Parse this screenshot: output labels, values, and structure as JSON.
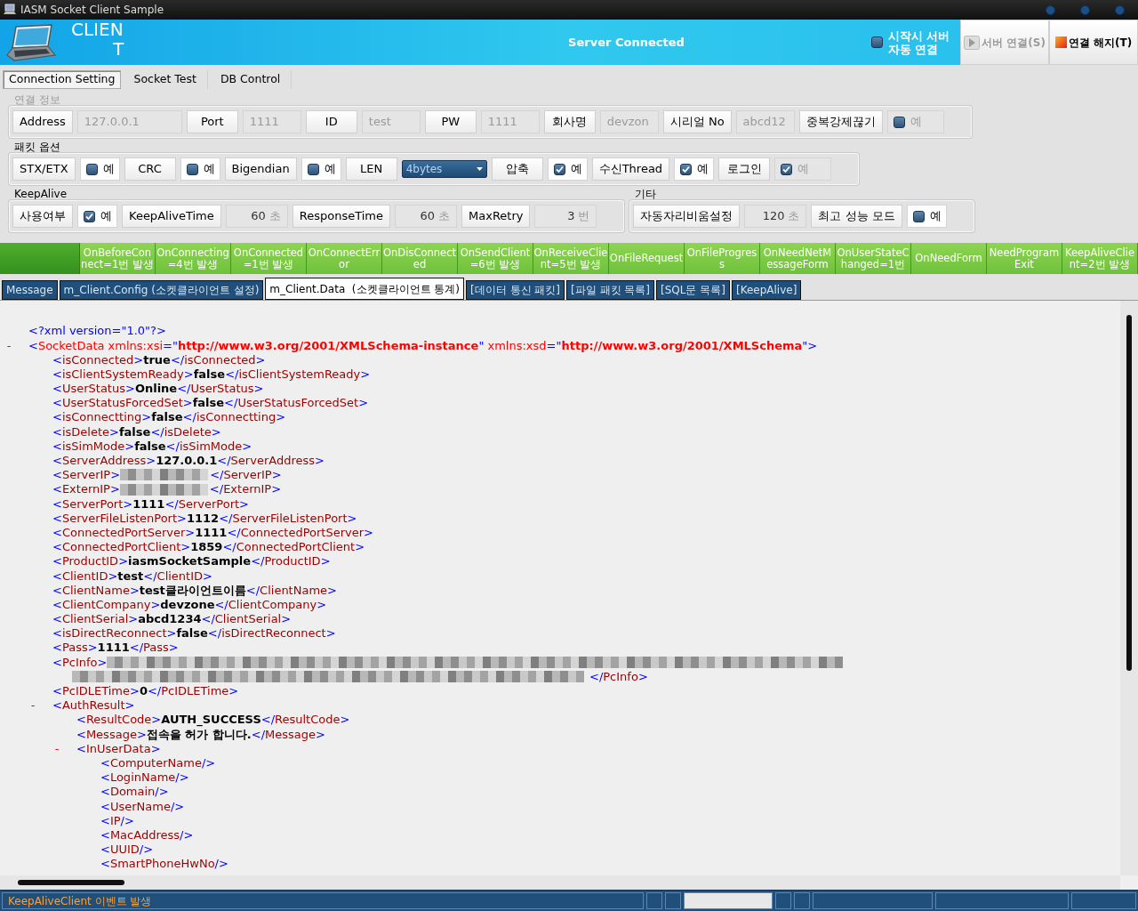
{
  "window": {
    "title": "IASM Socket Client Sample"
  },
  "header": {
    "logo_line_1": "CLIEN",
    "logo_line_2": "T",
    "status": "Server Connected",
    "auto_connect": {
      "label_lines": [
        "시작시 서버",
        "자동 연결"
      ],
      "checked": false
    },
    "buttons": [
      {
        "kind": "play",
        "label": "서버 연결(S)",
        "disabled": true
      },
      {
        "kind": "stop",
        "label": "연결 해지(T)",
        "disabled": false
      }
    ]
  },
  "main_tabs": [
    {
      "label": "Connection Setting",
      "selected": true
    },
    {
      "label": "Socket Test",
      "selected": false
    },
    {
      "label": "DB Control",
      "selected": false
    }
  ],
  "settings_rows": [
    {
      "groups": [
        {
          "legend": "연결 정보",
          "disabled": true,
          "items": [
            {
              "kind": "label",
              "text": "Address"
            },
            {
              "kind": "value",
              "text": "127.0.0.1",
              "wide": true
            },
            {
              "kind": "label",
              "text": "Port"
            },
            {
              "kind": "value",
              "text": "1111"
            },
            {
              "kind": "label",
              "text": "ID"
            },
            {
              "kind": "value",
              "text": "test"
            },
            {
              "kind": "label",
              "text": "PW"
            },
            {
              "kind": "value",
              "text": "1111"
            },
            {
              "kind": "label",
              "text": "회사명"
            },
            {
              "kind": "value",
              "text": "devzon"
            },
            {
              "kind": "label",
              "text": "시리얼 No"
            },
            {
              "kind": "value",
              "text": "abcd12"
            },
            {
              "kind": "label",
              "text": "중복강제끊기"
            },
            {
              "kind": "check",
              "text": "예",
              "checked": false,
              "disabled": true
            }
          ]
        }
      ]
    },
    {
      "groups": [
        {
          "legend": "패킷 옵션",
          "disabled": false,
          "items": [
            {
              "kind": "label",
              "text": "STX/ETX"
            },
            {
              "kind": "check",
              "text": "예",
              "checked": false,
              "disabled": false
            },
            {
              "kind": "label",
              "text": "CRC"
            },
            {
              "kind": "check",
              "text": "예",
              "checked": false,
              "disabled": false
            },
            {
              "kind": "label",
              "text": "Bigendian"
            },
            {
              "kind": "check",
              "text": "예",
              "checked": false,
              "disabled": false
            },
            {
              "kind": "label",
              "text": "LEN"
            },
            {
              "kind": "combo",
              "text": "4bytes"
            },
            {
              "kind": "label",
              "text": "압축"
            },
            {
              "kind": "check",
              "text": "예",
              "checked": true,
              "disabled": false
            },
            {
              "kind": "label",
              "text": "수신Thread"
            },
            {
              "kind": "check",
              "text": "예",
              "checked": true,
              "disabled": false
            },
            {
              "kind": "label",
              "text": "로그인"
            },
            {
              "kind": "check",
              "text": "예",
              "checked": true,
              "disabled": true
            }
          ]
        }
      ]
    },
    {
      "groups": [
        {
          "legend": "KeepAlive",
          "disabled": false,
          "items": [
            {
              "kind": "label",
              "text": "사용여부"
            },
            {
              "kind": "check",
              "text": "예",
              "checked": true,
              "disabled": false
            },
            {
              "kind": "label",
              "text": "KeepAliveTime"
            },
            {
              "kind": "value",
              "text": "60",
              "unit": "초"
            },
            {
              "kind": "label",
              "text": "ResponseTime"
            },
            {
              "kind": "value",
              "text": "60",
              "unit": "초"
            },
            {
              "kind": "label",
              "text": "MaxRetry"
            },
            {
              "kind": "value",
              "text": "3",
              "unit": "번"
            }
          ]
        },
        {
          "legend": "기타",
          "disabled": false,
          "items": [
            {
              "kind": "label",
              "text": "자동자리비움설정"
            },
            {
              "kind": "value",
              "text": "120",
              "unit": "초"
            },
            {
              "kind": "label",
              "text": "최고 성능 모드"
            },
            {
              "kind": "check",
              "text": "예",
              "checked": false,
              "disabled": false
            }
          ]
        }
      ]
    }
  ],
  "events": [
    {
      "lines": [
        "OnBeforeCon",
        "nect=1번 발생"
      ]
    },
    {
      "lines": [
        "OnConnecting",
        "=4번 발생"
      ]
    },
    {
      "lines": [
        "OnConnected",
        "=1번 발생"
      ]
    },
    {
      "lines": [
        "OnConnectErr",
        "or"
      ]
    },
    {
      "lines": [
        "OnDisConnect",
        "ed"
      ]
    },
    {
      "lines": [
        "OnSendClient",
        "=6번 발생"
      ]
    },
    {
      "lines": [
        "OnReceiveClie",
        "nt=5번 발생"
      ]
    },
    {
      "lines": [
        "OnFileRequest"
      ]
    },
    {
      "lines": [
        "OnFileProgres",
        "s"
      ]
    },
    {
      "lines": [
        "OnNeedNetM",
        "essageForm"
      ]
    },
    {
      "lines": [
        "OnUserStateC",
        "hanged=1번"
      ]
    },
    {
      "lines": [
        "OnNeedForm"
      ]
    },
    {
      "lines": [
        "NeedProgram",
        "Exit"
      ]
    },
    {
      "lines": [
        "KeepAliveClie",
        "nt=2번 발생"
      ]
    }
  ],
  "data_tabs": [
    {
      "label": "Message",
      "selected": false
    },
    {
      "label": "m_Client.Config (소켓클라이언트 설정)",
      "selected": false
    },
    {
      "label": "m_Client.Data  (소켓클라이언트 통계)",
      "selected": true
    },
    {
      "label": "[데이터 통신 패킷]",
      "selected": false
    },
    {
      "label": "[파일 패킷 목록]",
      "selected": false
    },
    {
      "label": "[SQL문 목록]",
      "selected": false
    },
    {
      "label": "[KeepAlive]",
      "selected": false
    }
  ],
  "xml": [
    {
      "kind": "decl",
      "open": "<?xml version=\"1.0\"?>"
    },
    {
      "kind": "element",
      "toggle": "-",
      "open": "<SocketData xmlns:xsi=\"http://www.w3.org/2001/XMLSchema-instance\" xmlns:xsd=\"http://www.w3.org/2001/XMLSchema\">",
      "children": [
        {
          "kind": "element",
          "open": "<isConnected>",
          "value": "true",
          "close": "</isConnected>"
        },
        {
          "kind": "element",
          "open": "<isClientSystemReady>",
          "value": "false",
          "close": "</isClientSystemReady>"
        },
        {
          "kind": "element",
          "open": "<UserStatus>",
          "value": "Online",
          "close": "</UserStatus>"
        },
        {
          "kind": "element",
          "open": "<UserStatusForcedSet>",
          "value": "false",
          "close": "</UserStatusForcedSet>"
        },
        {
          "kind": "element",
          "open": "<isConnectting>",
          "value": "false",
          "close": "</isConnectting>"
        },
        {
          "kind": "element",
          "open": "<isDelete>",
          "value": "false",
          "close": "</isDelete>"
        },
        {
          "kind": "element",
          "open": "<isSimMode>",
          "value": "false",
          "close": "</isSimMode>"
        },
        {
          "kind": "element",
          "open": "<ServerAddress>",
          "value": "127.0.0.1",
          "close": "</ServerAddress>"
        },
        {
          "kind": "masked",
          "open": "<ServerIP>",
          "close": "</ServerIP>"
        },
        {
          "kind": "masked",
          "open": "<ExternIP>",
          "close": "</ExternIP>"
        },
        {
          "kind": "element",
          "open": "<ServerPort>",
          "value": "1111",
          "close": "</ServerPort>"
        },
        {
          "kind": "element",
          "open": "<ServerFileListenPort>",
          "value": "1112",
          "close": "</ServerFileListenPort>"
        },
        {
          "kind": "element",
          "open": "<ConnectedPortServer>",
          "value": "1111",
          "close": "</ConnectedPortServer>"
        },
        {
          "kind": "element",
          "open": "<ConnectedPortClient>",
          "value": "1859",
          "close": "</ConnectedPortClient>"
        },
        {
          "kind": "element",
          "open": "<ProductID>",
          "value": "iasmSocketSample",
          "close": "</ProductID>"
        },
        {
          "kind": "element",
          "open": "<ClientID>",
          "value": "test",
          "close": "</ClientID>"
        },
        {
          "kind": "element",
          "open": "<ClientName>",
          "value": "test클라이언트이름",
          "close": "</ClientName>"
        },
        {
          "kind": "element",
          "open": "<ClientCompany>",
          "value": "devzone",
          "close": "</ClientCompany>"
        },
        {
          "kind": "element",
          "open": "<ClientSerial>",
          "value": "abcd1234",
          "close": "</ClientSerial>"
        },
        {
          "kind": "element",
          "open": "<isDirectReconnect>",
          "value": "false",
          "close": "</isDirectReconnect>"
        },
        {
          "kind": "element",
          "open": "<Pass>",
          "value": "1111",
          "close": "</Pass>"
        },
        {
          "kind": "masked_wrapped",
          "open": "<PcInfo>",
          "close": "</PcInfo>"
        },
        {
          "kind": "element",
          "open": "<PcIDLETime>",
          "value": "0",
          "close": "</PcIDLETime>"
        },
        {
          "kind": "element",
          "toggle": "-",
          "open": "<AuthResult>",
          "children": [
            {
              "kind": "element",
              "open": "<ResultCode>",
              "value": "AUTH_SUCCESS",
              "close": "</ResultCode>"
            },
            {
              "kind": "element",
              "open": "<Message>",
              "value": "접속을 허가 합니다.",
              "close": "</Message>"
            },
            {
              "kind": "element",
              "toggle": "-",
              "open": "<InUserData>",
              "children": [
                {
                  "kind": "empty",
                  "open": "<ComputerName/>"
                },
                {
                  "kind": "empty",
                  "open": "<LoginName/>"
                },
                {
                  "kind": "empty",
                  "open": "<Domain/>"
                },
                {
                  "kind": "empty",
                  "open": "<UserName/>"
                },
                {
                  "kind": "empty",
                  "open": "<IP/>"
                },
                {
                  "kind": "empty",
                  "open": "<MacAddress/>"
                },
                {
                  "kind": "empty",
                  "open": "<UUID/>"
                },
                {
                  "kind": "empty",
                  "open": "<SmartPhoneHwNo/>"
                }
              ]
            }
          ]
        }
      ]
    }
  ],
  "status_bar": {
    "message": "KeepAliveClient 이벤트 발생"
  }
}
